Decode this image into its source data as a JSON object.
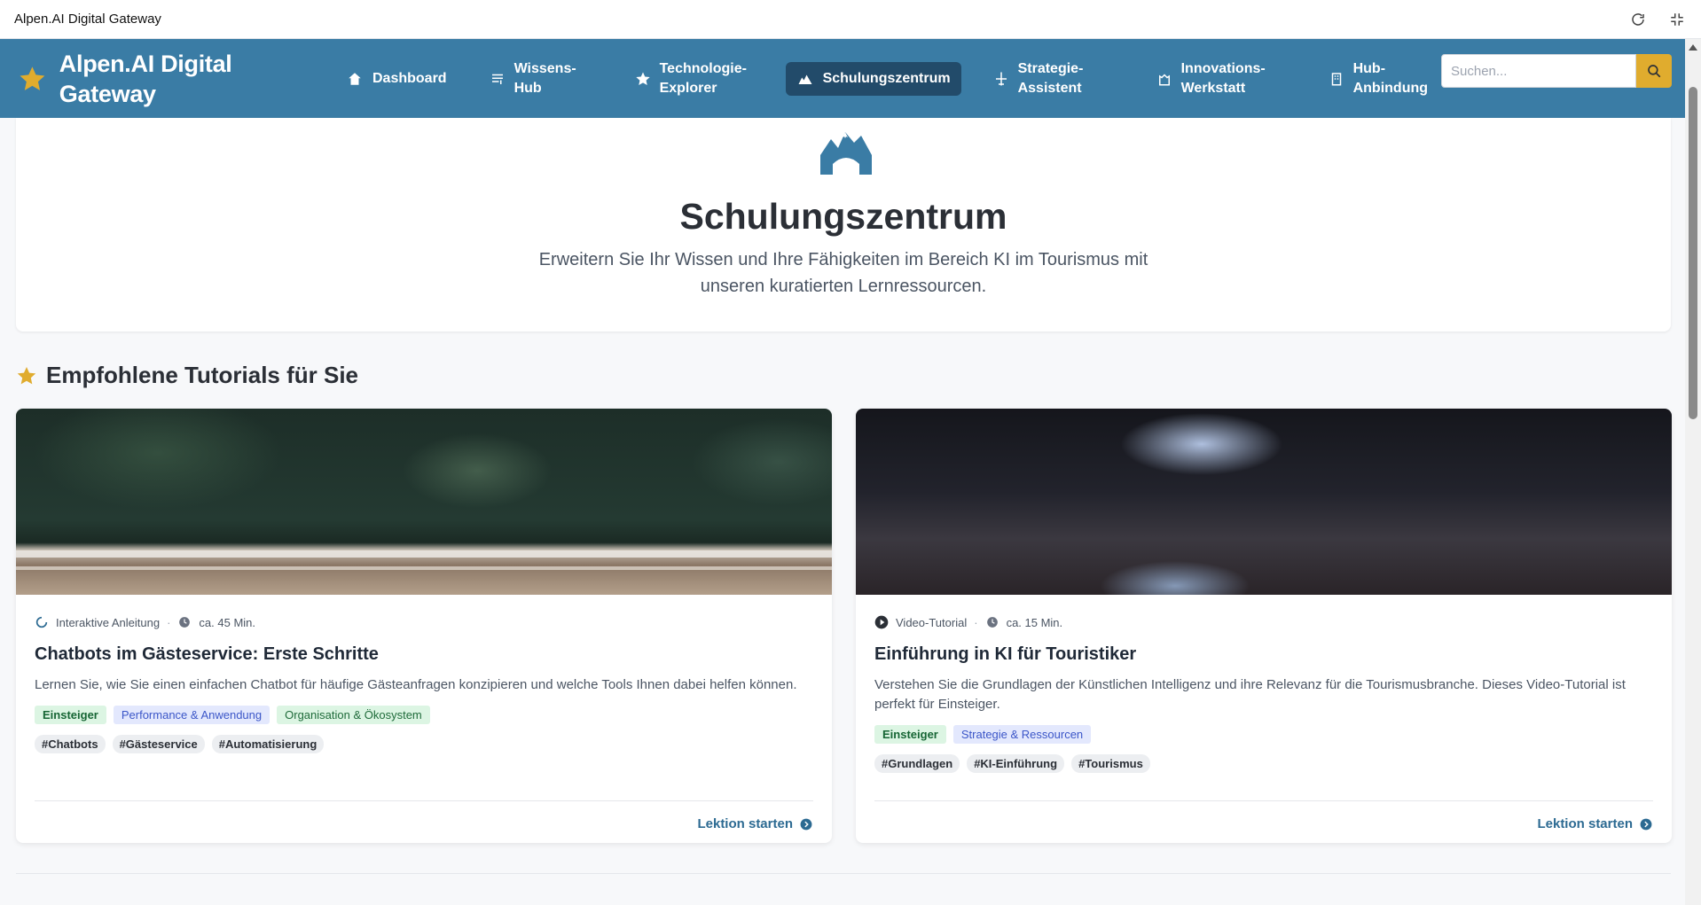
{
  "window": {
    "title": "Alpen.AI Digital Gateway"
  },
  "navbar": {
    "brand": "Alpen.AI Digital Gateway",
    "items": [
      {
        "label": "Dashboard",
        "icon": "home-icon",
        "active": false
      },
      {
        "label": "Wissens-Hub",
        "icon": "list-icon",
        "active": false
      },
      {
        "label": "Technologie-Explorer",
        "icon": "star-icon",
        "active": false
      },
      {
        "label": "Schulungszentrum",
        "icon": "mountain-icon",
        "active": true
      },
      {
        "label": "Strategie-Assistent",
        "icon": "plane-icon",
        "active": false
      },
      {
        "label": "Innovations-Werkstatt",
        "icon": "castle-icon",
        "active": false
      },
      {
        "label": "Hub-Anbindung",
        "icon": "building-icon",
        "active": false
      }
    ],
    "search_placeholder": "Suchen..."
  },
  "hero": {
    "icon": "mountain-icon",
    "title": "Schulungszentrum",
    "subtitle": "Erweitern Sie Ihr Wissen und Ihre Fähigkeiten im Bereich KI im Tourismus mit unseren kuratierten Lernressourcen."
  },
  "section": {
    "title": "Empfohlene Tutorials für Sie",
    "icon": "star-icon"
  },
  "cards": [
    {
      "type": "Interaktive Anleitung",
      "type_icon": "interactive-icon",
      "duration": "ca. 45 Min.",
      "title": "Chatbots im Gästeservice: Erste Schritte",
      "description": "Lernen Sie, wie Sie einen einfachen Chatbot für häufige Gästeanfragen konzipieren und welche Tools Ihnen dabei helfen können.",
      "level": "Einsteiger",
      "categories": [
        "Performance & Anwendung",
        "Organisation & Ökosystem"
      ],
      "tags": [
        "#Chatbots",
        "#Gästeservice",
        "#Automatisierung"
      ],
      "action": "Lektion starten"
    },
    {
      "type": "Video-Tutorial",
      "type_icon": "play-icon",
      "duration": "ca. 15 Min.",
      "title": "Einführung in KI für Touristiker",
      "description": "Verstehen Sie die Grundlagen der Künstlichen Intelligenz und ihre Relevanz für die Tourismusbranche. Dieses Video-Tutorial ist perfekt für Einsteiger.",
      "level": "Einsteiger",
      "categories": [
        "Strategie & Ressourcen"
      ],
      "tags": [
        "#Grundlagen",
        "#KI-Einführung",
        "#Tourismus"
      ],
      "action": "Lektion starten"
    }
  ],
  "colors": {
    "nav_bg": "#3a7ca5",
    "nav_active": "#224b6a",
    "accent_gold": "#e0ac2e",
    "link": "#2c6a92"
  }
}
